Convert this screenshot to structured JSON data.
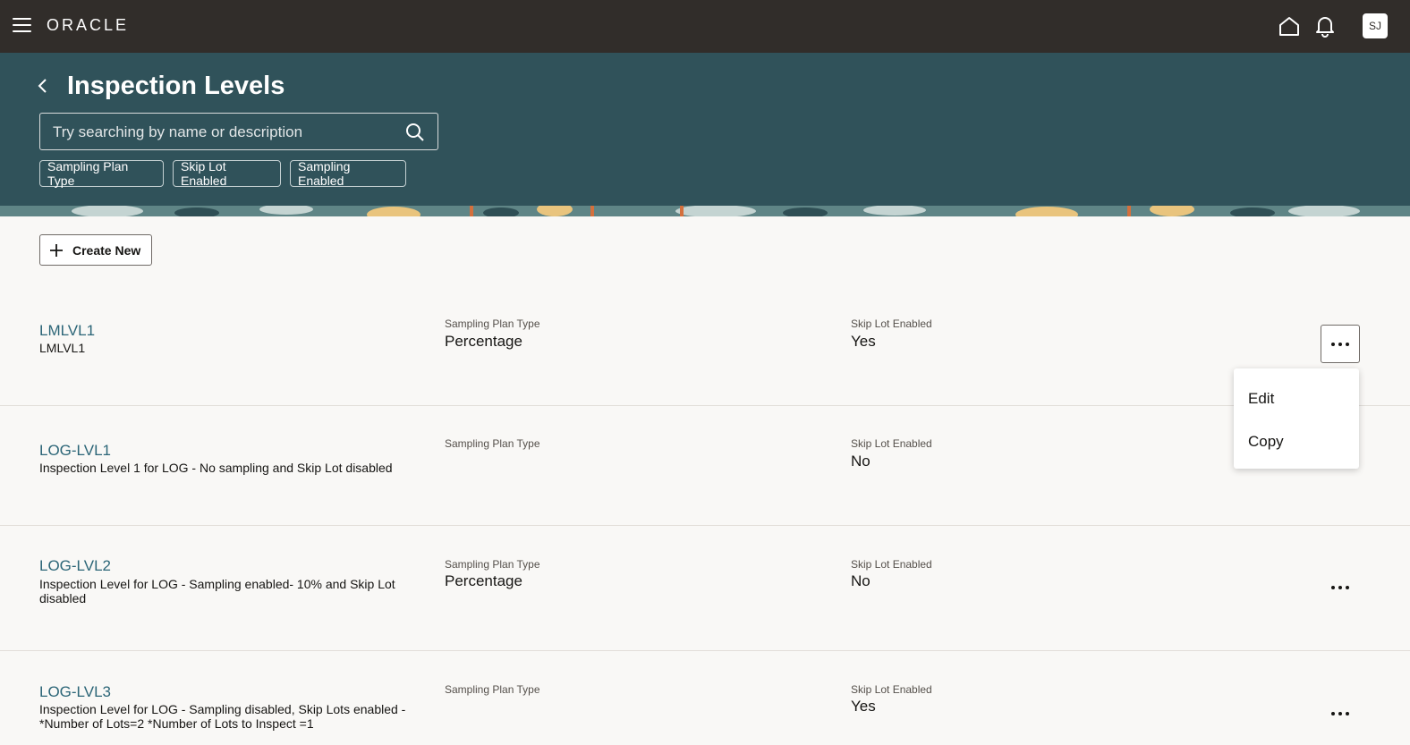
{
  "topbar": {
    "logo": "ORACLE",
    "avatar_initials": "SJ",
    "icons": [
      "menu-icon",
      "home-icon",
      "bell-icon"
    ]
  },
  "header": {
    "title": "Inspection Levels",
    "search_placeholder": "Try searching by name or description",
    "filters": [
      "Sampling Plan Type",
      "Skip Lot Enabled",
      "Sampling Enabled"
    ]
  },
  "toolbar": {
    "create_label": "Create New"
  },
  "columns": {
    "sampling_label": "Sampling Plan Type",
    "skip_label": "Skip Lot Enabled"
  },
  "items": [
    {
      "name": "LMLVL1",
      "description": "LMLVL1",
      "sampling_plan_type": "Percentage",
      "skip_lot_enabled": "Yes"
    },
    {
      "name": "LOG-LVL1",
      "description": "Inspection Level 1 for LOG - No sampling and Skip Lot disabled",
      "sampling_plan_type": "",
      "skip_lot_enabled": "No"
    },
    {
      "name": "LOG-LVL2",
      "description": "Inspection Level for LOG - Sampling enabled- 10% and Skip Lot disabled",
      "sampling_plan_type": "Percentage",
      "skip_lot_enabled": "No"
    },
    {
      "name": "LOG-LVL3",
      "description": "Inspection Level for LOG - Sampling disabled, Skip Lots enabled - *Number of Lots=2 *Number of Lots to Inspect =1",
      "sampling_plan_type": "",
      "skip_lot_enabled": "Yes"
    }
  ],
  "menu": {
    "edit": "Edit",
    "copy": "Copy"
  },
  "colors": {
    "topbar": "#312d2a",
    "header": "#30525a",
    "link": "#2b6577",
    "background": "#f9f8f6"
  }
}
